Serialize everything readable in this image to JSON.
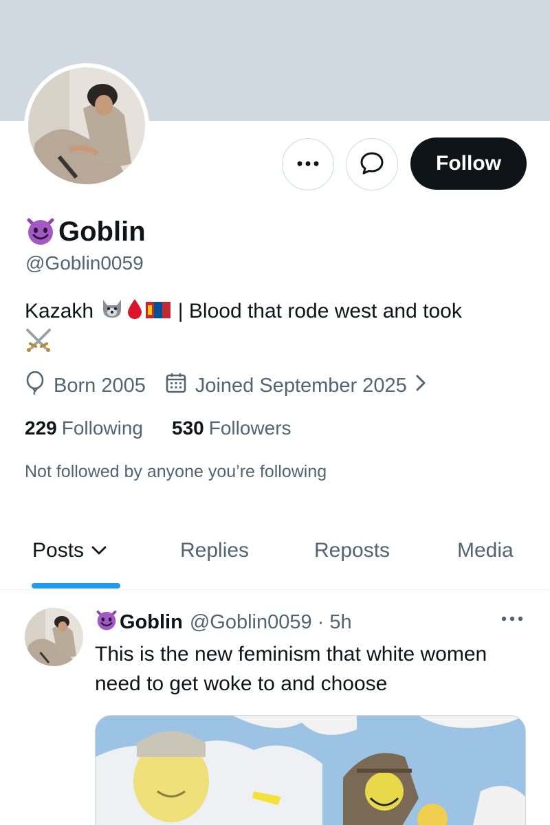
{
  "profile": {
    "display_name": "Goblin",
    "handle": "@Goblin0059",
    "bio_text": "Kazakh",
    "bio_separator": "| Blood that rode west and took",
    "bio_emojis": [
      "wolf-emoji",
      "drop-of-blood-emoji",
      "mongolia-flag-emoji",
      "crossed-swords-emoji"
    ],
    "name_emoji": "smiling-devil-emoji",
    "born": "Born 2005",
    "joined": "Joined September 2025",
    "following_count": "229",
    "following_label": "Following",
    "followers_count": "530",
    "followers_label": "Followers",
    "not_followed": "Not followed by anyone you’re following"
  },
  "actions": {
    "more_label": "More",
    "message_label": "Message",
    "follow_label": "Follow"
  },
  "tabs": [
    {
      "label": "Posts",
      "active": true
    },
    {
      "label": "Replies",
      "active": false
    },
    {
      "label": "Reposts",
      "active": false
    },
    {
      "label": "Media",
      "active": false
    }
  ],
  "post": {
    "name": "Goblin",
    "handle_time": "@Goblin0059 · 5h",
    "text": "This is the new feminism that white women need to get woke to and choose"
  },
  "colors": {
    "accent": "#1d9bf0",
    "banner": "#cfd9df",
    "text_primary": "#0f1419",
    "text_secondary": "#536471",
    "follow_bg": "#0f1419"
  }
}
